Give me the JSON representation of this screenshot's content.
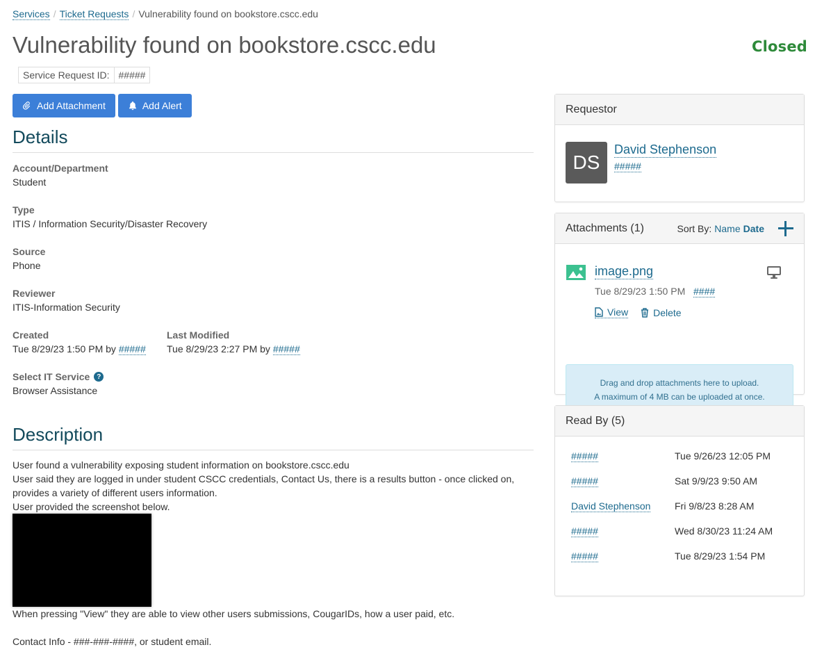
{
  "breadcrumb": {
    "items": [
      "Services",
      "Ticket Requests"
    ],
    "current": "Vulnerability found on bookstore.cscc.edu"
  },
  "title": "Vulnerability found on bookstore.cscc.edu",
  "status": {
    "label": "Closed",
    "color": "#2e8a3a"
  },
  "service_request": {
    "label": "Service Request ID:",
    "value": "#####"
  },
  "toolbar": {
    "add_attachment": "Add Attachment",
    "add_alert": "Add Alert",
    "accent": "#3c7fd8"
  },
  "details": {
    "heading": "Details",
    "account_label": "Account/Department",
    "account_value": "Student",
    "type_label": "Type",
    "type_value": "ITIS / Information Security/Disaster Recovery",
    "source_label": "Source",
    "source_value": "Phone",
    "reviewer_label": "Reviewer",
    "reviewer_value": "ITIS-Information Security",
    "created_label": "Created",
    "created_value": "Tue 8/29/23 1:50 PM by",
    "created_by": "#####",
    "modified_label": "Last Modified",
    "modified_value": "Tue 8/29/23 2:27 PM by",
    "modified_by": "#####",
    "service_label": "Select IT Service",
    "service_help": "?",
    "service_value": "Browser Assistance"
  },
  "description": {
    "heading": "Description",
    "line1": "User found a vulnerability exposing student information on bookstore.cscc.edu",
    "line2": "User said they are logged in under student CSCC credentials, Contact Us, there is a results button - once clicked on, provides a variety of different users information.",
    "line3": "User provided the screenshot below.",
    "line4": "When pressing \"View\" they are able to view other users submissions, CougarIDs, how a user paid, etc.",
    "line5": "Contact Info - ###-###-####, or student email."
  },
  "requestor": {
    "heading": "Requestor",
    "initials": "DS",
    "name": "David Stephenson",
    "id": "#####"
  },
  "attachments": {
    "heading": "Attachments (1)",
    "sort_label": "Sort By:",
    "sort_name": "Name",
    "sort_date": "Date",
    "items": [
      {
        "name": "image.png",
        "date": "Tue 8/29/23 1:50 PM",
        "by": "####",
        "view": "View",
        "delete": "Delete"
      }
    ],
    "drop_line1": "Drag and drop attachments here to upload.",
    "drop_line2": "A maximum of 4 MB can be uploaded at once."
  },
  "read_by": {
    "heading": "Read By (5)",
    "rows": [
      {
        "who": "#####",
        "when": "Tue 9/26/23 12:05 PM"
      },
      {
        "who": "#####",
        "when": "Sat 9/9/23 9:50 AM"
      },
      {
        "who": "David Stephenson",
        "when": "Fri 9/8/23 8:28 AM"
      },
      {
        "who": "#####",
        "when": "Wed 8/30/23 11:24 AM"
      },
      {
        "who": "#####",
        "when": "Tue 8/29/23 1:54 PM"
      }
    ]
  }
}
